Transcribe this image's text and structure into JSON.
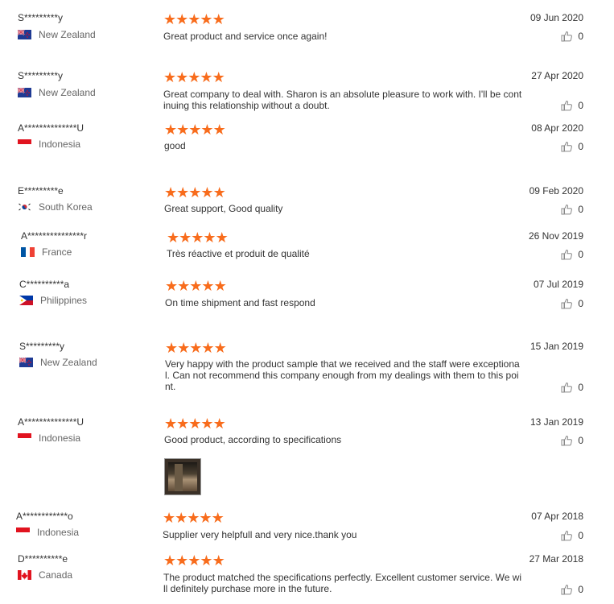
{
  "reviews": [
    {
      "name": "S*********y",
      "country": "New Zealand",
      "flag": "nz",
      "rating": 5,
      "date": "09 Jun 2020",
      "text": "Great product and service once again!",
      "likes": "0"
    },
    {
      "name": "S*********y",
      "country": "New Zealand",
      "flag": "nz",
      "rating": 5,
      "date": "27 Apr 2020",
      "text": "Great company to deal with.  Sharon is an absolute pleasure to work with.  I'll be continuing this relationship without a doubt.",
      "likes": "0"
    },
    {
      "name": "A**************U",
      "country": "Indonesia",
      "flag": "id",
      "rating": 5,
      "date": "08 Apr 2020",
      "text": "good",
      "likes": "0"
    },
    {
      "name": "E*********e",
      "country": "South Korea",
      "flag": "kr",
      "rating": 5,
      "date": "09 Feb 2020",
      "text": "Great support, Good quality",
      "likes": "0"
    },
    {
      "name": "A***************r",
      "country": "France",
      "flag": "fr",
      "rating": 5,
      "date": "26 Nov 2019",
      "text": "Très réactive et produit de qualité",
      "likes": "0"
    },
    {
      "name": "C**********a",
      "country": "Philippines",
      "flag": "ph",
      "rating": 5,
      "date": "07 Jul 2019",
      "text": "On time shipment and fast respond",
      "likes": "0"
    },
    {
      "name": "S*********y",
      "country": "New Zealand",
      "flag": "nz",
      "rating": 5,
      "date": "15 Jan 2019",
      "text": "Very happy with the product sample that we received and the staff were exceptional.  Can not recommend  this company enough from my dealings with them to this point.",
      "likes": "0"
    },
    {
      "name": "A**************U",
      "country": "Indonesia",
      "flag": "id",
      "rating": 5,
      "date": "13 Jan 2019",
      "text": "Good product, according to specifications",
      "likes": "0"
    },
    {
      "name": "A************o",
      "country": "Indonesia",
      "flag": "id",
      "rating": 5,
      "date": "07 Apr 2018",
      "text": "Supplier very helpfull and very nice.thank you",
      "likes": "0"
    },
    {
      "name": "D**********e",
      "country": "Canada",
      "flag": "ca",
      "rating": 5,
      "date": "27 Mar 2018",
      "text": "The product matched the specifications perfectly. Excellent customer service. We will definitely purchase more in the future.",
      "likes": "0"
    }
  ],
  "icons": {
    "star": "star-icon",
    "like": "thumbs-up-icon"
  },
  "colors": {
    "star": "#f86c1c"
  }
}
